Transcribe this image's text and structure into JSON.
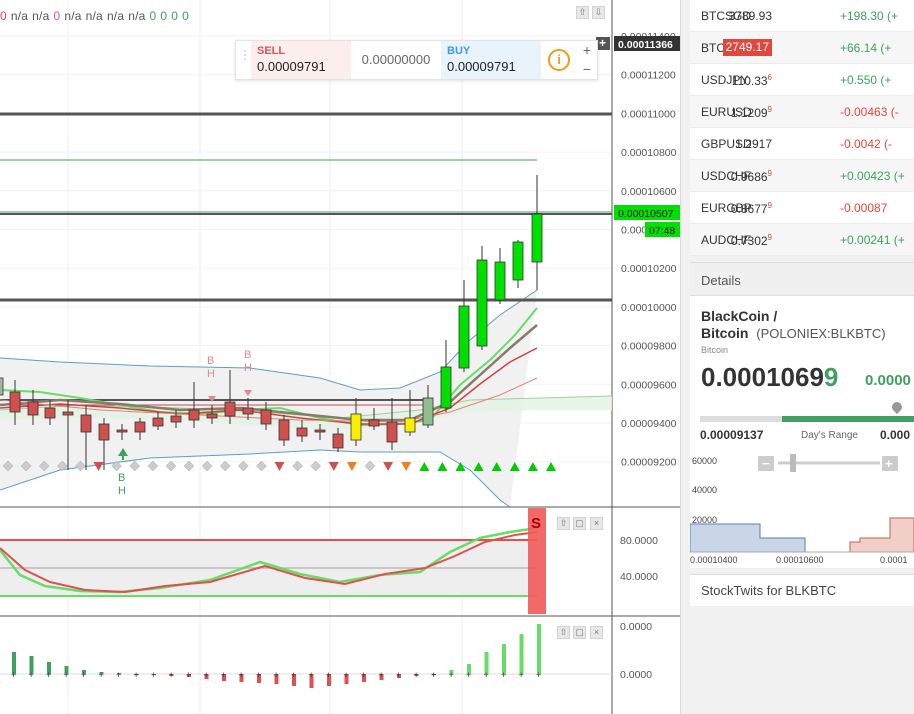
{
  "indicator_values": [
    {
      "text": "0",
      "color": "#e0483e"
    },
    {
      "text": "n/a",
      "color": "#555555"
    },
    {
      "text": "n/a",
      "color": "#555555"
    },
    {
      "text": "0",
      "color": "#d04ad0"
    },
    {
      "text": "n/a",
      "color": "#555555"
    },
    {
      "text": "n/a",
      "color": "#555555"
    },
    {
      "text": "n/a",
      "color": "#555555"
    },
    {
      "text": "n/a",
      "color": "#555555"
    },
    {
      "text": "0",
      "color": "#3fa060"
    },
    {
      "text": "0",
      "color": "#3fa060"
    },
    {
      "text": "0",
      "color": "#3fa060"
    },
    {
      "text": "0",
      "color": "#3fa060"
    }
  ],
  "trade": {
    "sell_label": "SELL",
    "sell_price": "0.00009791",
    "spread": "0.00000000",
    "buy_label": "BUY",
    "buy_price": "0.00009791",
    "info_glyph": "i",
    "plus": "+",
    "minus": "−"
  },
  "price_axis": {
    "ticks": [
      "0.00011400",
      "0.00011200",
      "0.00011000",
      "0.00010800",
      "0.00010600",
      "0.00010400",
      "0.00010200",
      "0.00010000",
      "0.00009800",
      "0.00009600",
      "0.00009400",
      "0.00009200"
    ],
    "cross_label": "0.00011366",
    "current_label": "0.00010507",
    "countdown": "07:48"
  },
  "osc_axis": {
    "ticks": [
      "80.0000",
      "40.0000"
    ],
    "signal": "S"
  },
  "macd_axis": {
    "ticks": [
      "0.0000",
      "0.0000"
    ]
  },
  "chart_markers": {
    "b": "B",
    "h": "H"
  },
  "watchlist": [
    {
      "symbol": "BTCSGD",
      "last": "3789.93",
      "change": "+198.30 (+",
      "dir": "pos"
    },
    {
      "symbol": "BTCUSD",
      "last": "2749.17",
      "change": "+66.14 (+",
      "dir": "pos",
      "highlight": true
    },
    {
      "symbol": "USDJPY",
      "last": "110.33",
      "sup": "6",
      "change": "+0.550 (+",
      "dir": "pos"
    },
    {
      "symbol": "EURUSD",
      "last": "1.1209",
      "sup": "9",
      "change": "-0.00463 (-",
      "dir": "neg"
    },
    {
      "symbol": "GBPUSD",
      "last": "1.2917",
      "change": "-0.0042 (-",
      "dir": "neg"
    },
    {
      "symbol": "USDCHF",
      "last": "0.9686",
      "sup": "9",
      "change": "+0.00423 (+",
      "dir": "pos"
    },
    {
      "symbol": "EURGBP",
      "last": "0.8677",
      "sup": "9",
      "change": "-0.00087",
      "dir": "neg"
    },
    {
      "symbol": "AUDCHF",
      "last": "0.7302",
      "sup": "9",
      "change": "+0.00241 (+",
      "dir": "pos"
    }
  ],
  "details": {
    "header": "Details",
    "name_line1": "BlackCoin /",
    "name_line2": "Bitcoin",
    "exchange": "(POLONIEX:BLKBTC)",
    "subtitle": "Bitcoin",
    "price_main": "0.0001069",
    "price_last": "9",
    "change": "0.0000",
    "range_low": "0.00009137",
    "range_label": "Day's Range",
    "range_high": "0.000",
    "depth_ticks": [
      "60000",
      "40000",
      "20000"
    ],
    "depth_x": [
      "0.00010400",
      "0.00010600",
      "0.0001"
    ],
    "depth_minus": "−",
    "depth_plus": "+"
  },
  "stocktwits": "StockTwits for BLKBTC",
  "colors": {
    "up": "#00e000",
    "down": "#e05050",
    "green_text": "#3fa060",
    "red_text": "#e0483e"
  }
}
